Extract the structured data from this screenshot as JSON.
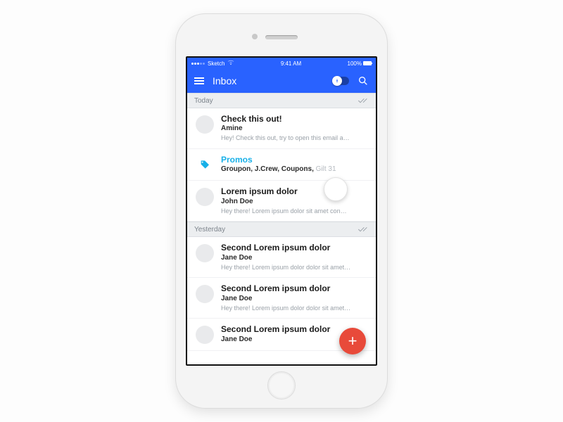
{
  "status": {
    "carrier": "Sketch",
    "time": "9:41 AM",
    "battery": "100%"
  },
  "header": {
    "title": "Inbox"
  },
  "sections": [
    {
      "label": "Today",
      "rows": [
        {
          "kind": "mail",
          "subject": "Check this out!",
          "from": "Amine",
          "preview": "Hey! Check this out, try to open this email a…"
        },
        {
          "kind": "promo",
          "subject": "Promos",
          "from": "Groupon, J.Crew, Coupons,",
          "from_muted": "Gilt 31"
        },
        {
          "kind": "mail",
          "subject": "Lorem ipsum dolor",
          "from": "John Doe",
          "preview": "Hey there! Lorem ipsum dolor sit amet con…"
        }
      ]
    },
    {
      "label": "Yesterday",
      "rows": [
        {
          "kind": "mail",
          "subject": "Second Lorem ipsum dolor",
          "from": "Jane Doe",
          "preview": "Hey there! Lorem ipsum dolor dolor sit amet…"
        },
        {
          "kind": "mail",
          "subject": "Second Lorem ipsum dolor",
          "from": "Jane Doe",
          "preview": "Hey there! Lorem ipsum dolor dolor sit amet…"
        },
        {
          "kind": "mail",
          "subject": "Second Lorem ipsum dolor",
          "from": "Jane Doe"
        }
      ]
    }
  ],
  "fab_label": "+"
}
